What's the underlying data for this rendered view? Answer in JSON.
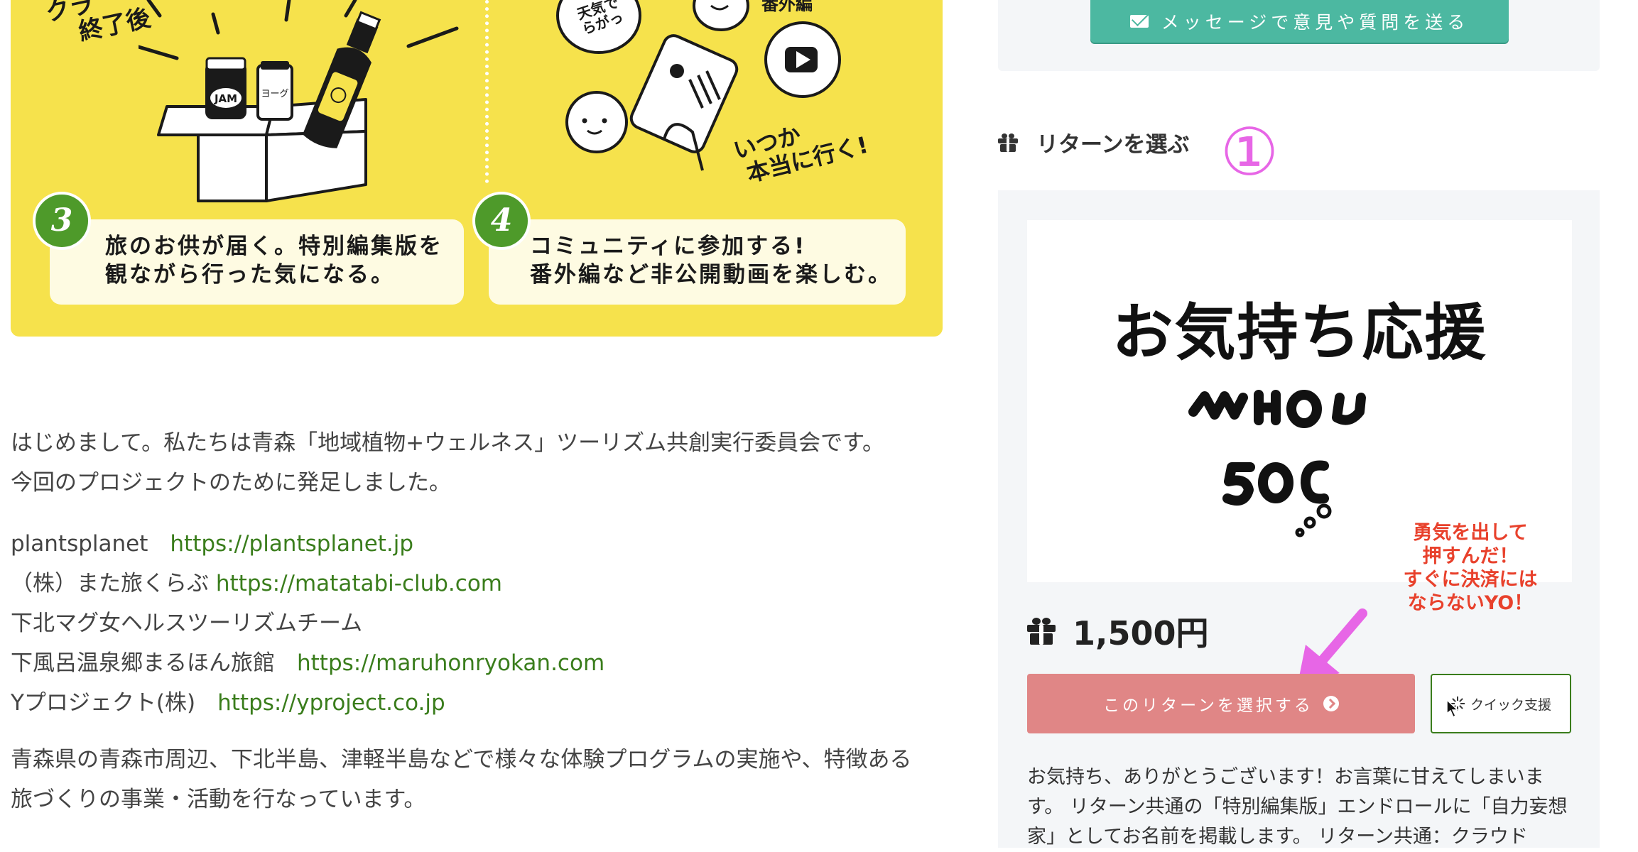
{
  "banner": {
    "top_left_note": [
      "クラ",
      "終了後"
    ],
    "jar_label": "JAM",
    "bottle_label": "ヨーグ",
    "bubble_weather": [
      "天気で",
      "らがっ"
    ],
    "bubble_extra": "番外編",
    "handwritten_promise": [
      "いつか",
      "本当に行く!"
    ],
    "step3": {
      "number": "3",
      "lines": [
        "旅のお供が届く。特別編集版を",
        "観ながら行った気になる。"
      ]
    },
    "step4": {
      "number": "4",
      "lines": [
        "コミュニティに参加する!",
        "番外編など非公開動画を楽しむ。"
      ]
    }
  },
  "article": {
    "intro": [
      "はじめまして。私たちは青森「地域植物+ウェルネス」ツーリズム共創実行委員会です。",
      "今回のプロジェクトのために発足しました。"
    ],
    "members": [
      {
        "name": "plantsplanet　",
        "url": "https://plantsplanet.jp"
      },
      {
        "name": "（株）また旅くらぶ ",
        "url": "https://matatabi-club.com"
      },
      {
        "name": "下北マグ女ヘルスツーリズムチーム",
        "url": ""
      },
      {
        "name": "下風呂温泉郷まるほん旅館　",
        "url": "https://maruhonryokan.com"
      },
      {
        "name": "Yプロジェクト(株)　",
        "url": "https://yproject.co.jp"
      }
    ],
    "activities": [
      "青森県の青森市周辺、下北半島、津軽半島などで様々な体験プログラムの実施や、特徴ある",
      "旅づくりの事業・活動を行なっています。"
    ]
  },
  "sidebar": {
    "message_button": "メッセージで意見や質問を送る",
    "returns_heading": "リターンを選ぶ",
    "step_marker": "①",
    "reward": {
      "image_title": "お気持ち応援",
      "price": "1,500円",
      "select_button": "このリターンを選択する",
      "quick_button": "クイック支援",
      "description": "お気持ち、ありがとうございます！お言葉に甘えてしまいます。 リターン共通の「特別編集版」エンドロールに「自力妄想家」としてお名前を掲載します。 リターン共通：クラウド"
    },
    "annotation": [
      "勇気を出して",
      "押すんだ！",
      "すぐに決済には",
      "ならないYO！"
    ]
  },
  "colors": {
    "banner_yellow": "#f6e24c",
    "step_green": "#4e9a2a",
    "link_green": "#3a7d1c",
    "message_button_teal": "#4cb8a1",
    "select_button_pink": "#e08686",
    "marker_magenta": "#e766e6",
    "annotation_red": "#e8412c"
  }
}
